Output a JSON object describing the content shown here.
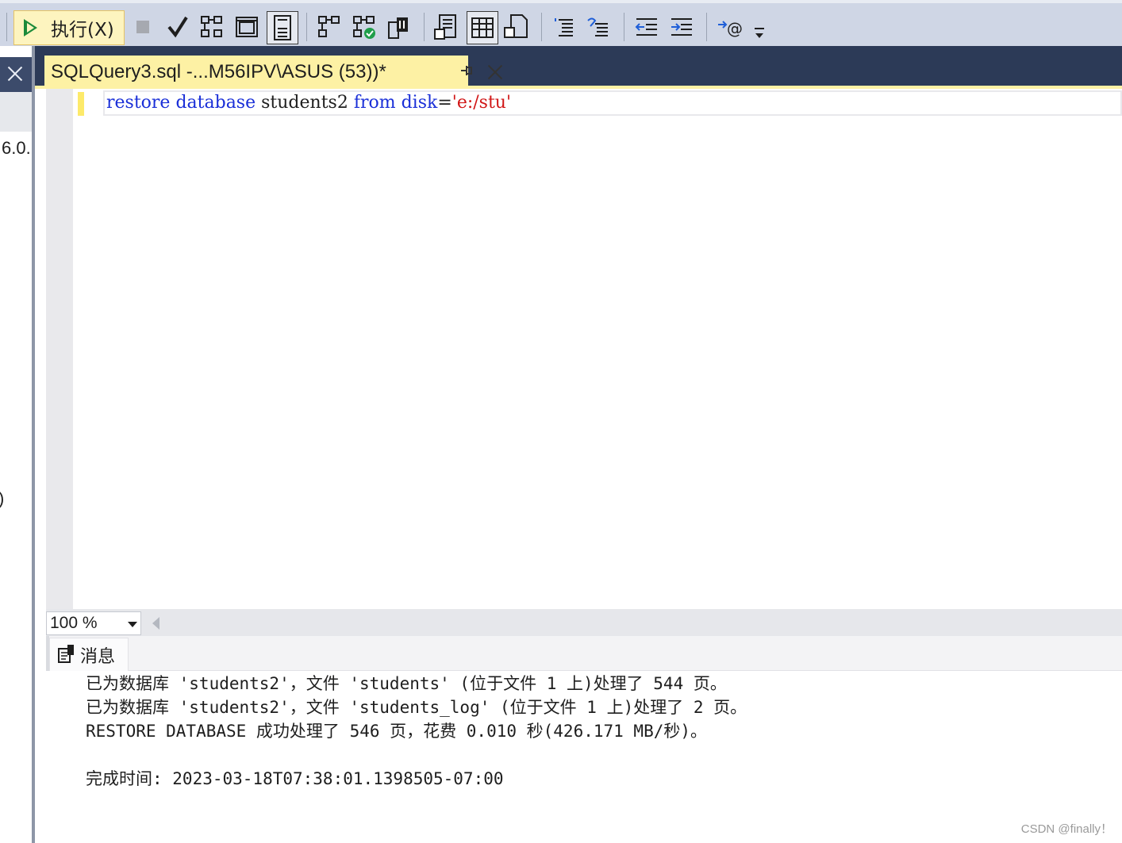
{
  "toolbar": {
    "execute_label": "执行(X)",
    "dropdown_icon": "overflow-dropdown-icon"
  },
  "left_panel": {
    "version_fragment": "6.0.",
    "paren_fragment": ")"
  },
  "document_tab": {
    "title": "SQLQuery3.sql -...M56IPV\\ASUS (53))*"
  },
  "editor": {
    "tokens": [
      {
        "text": "restore",
        "kind": "keyword"
      },
      {
        "text": " ",
        "kind": "plain"
      },
      {
        "text": "database",
        "kind": "keyword"
      },
      {
        "text": " students2 ",
        "kind": "plain"
      },
      {
        "text": "from",
        "kind": "keyword"
      },
      {
        "text": " ",
        "kind": "plain"
      },
      {
        "text": "disk",
        "kind": "keyword"
      },
      {
        "text": "=",
        "kind": "plain"
      },
      {
        "text": "'e:/stu'",
        "kind": "string"
      }
    ]
  },
  "zoom": {
    "value": "100 %"
  },
  "results": {
    "tab_label": "消息",
    "messages": [
      "已为数据库 'students2'，文件 'students' (位于文件 1 上)处理了 544 页。",
      "已为数据库 'students2'，文件 'students_log' (位于文件 1 上)处理了 2 页。",
      "RESTORE DATABASE 成功处理了 546 页，花费 0.010 秒(426.171 MB/秒)。",
      "",
      "完成时间: 2023-03-18T07:38:01.1398505-07:00"
    ]
  },
  "watermark": "CSDN @finally！",
  "colors": {
    "keyword": "#1a2fd8",
    "string": "#d11616",
    "tab_active": "#fdf1a4",
    "header_dark": "#2c3a57"
  }
}
